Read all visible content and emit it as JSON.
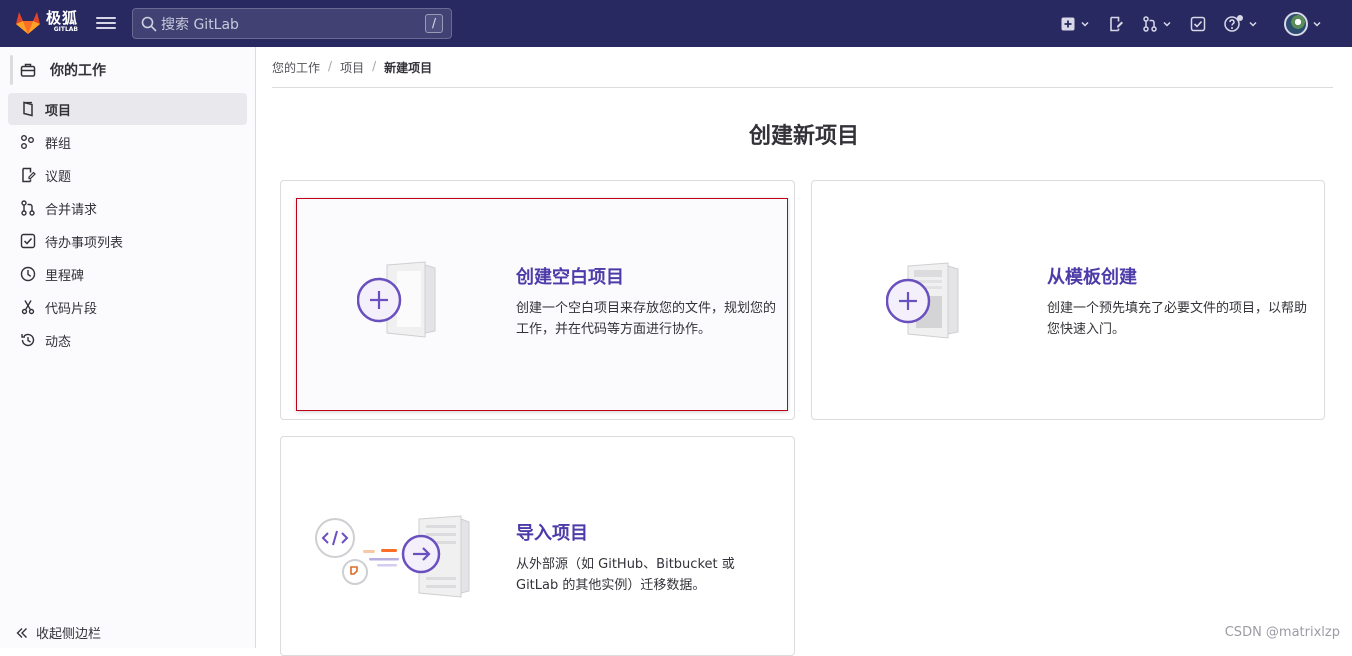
{
  "topbar": {
    "logo_cn": "极狐",
    "logo_en": "GITLAB",
    "search_placeholder": "搜索 GitLab",
    "search_shortcut": "/"
  },
  "sidebar": {
    "header": "你的工作",
    "items": [
      {
        "label": "项目",
        "icon": "project-icon",
        "active": true
      },
      {
        "label": "群组",
        "icon": "group-icon",
        "active": false
      },
      {
        "label": "议题",
        "icon": "issues-icon",
        "active": false
      },
      {
        "label": "合并请求",
        "icon": "merge-request-icon",
        "active": false
      },
      {
        "label": "待办事项列表",
        "icon": "todo-icon",
        "active": false
      },
      {
        "label": "里程碑",
        "icon": "clock-icon",
        "active": false
      },
      {
        "label": "代码片段",
        "icon": "scissors-icon",
        "active": false
      },
      {
        "label": "动态",
        "icon": "history-icon",
        "active": false
      }
    ],
    "collapse_label": "收起侧边栏"
  },
  "breadcrumb": {
    "items": [
      "您的工作",
      "项目"
    ],
    "current": "新建项目"
  },
  "main": {
    "title": "创建新项目",
    "cards": [
      {
        "title": "创建空白项目",
        "desc": "创建一个空白项目来存放您的文件，规划您的工作，并在代码等方面进行协作。"
      },
      {
        "title": "从模板创建",
        "desc": "创建一个预先填充了必要文件的项目，以帮助您快速入门。"
      },
      {
        "title": "导入项目",
        "desc": "从外部源（如 GitHub、Bitbucket 或 GitLab 的其他实例）迁移数据。"
      }
    ]
  },
  "watermark": "CSDN @matrixlzp",
  "colors": {
    "topbar": "#292961",
    "accent": "#4c3ba8",
    "highlight_border": "#c0001a",
    "sidebar_bg": "#fbfafd"
  }
}
